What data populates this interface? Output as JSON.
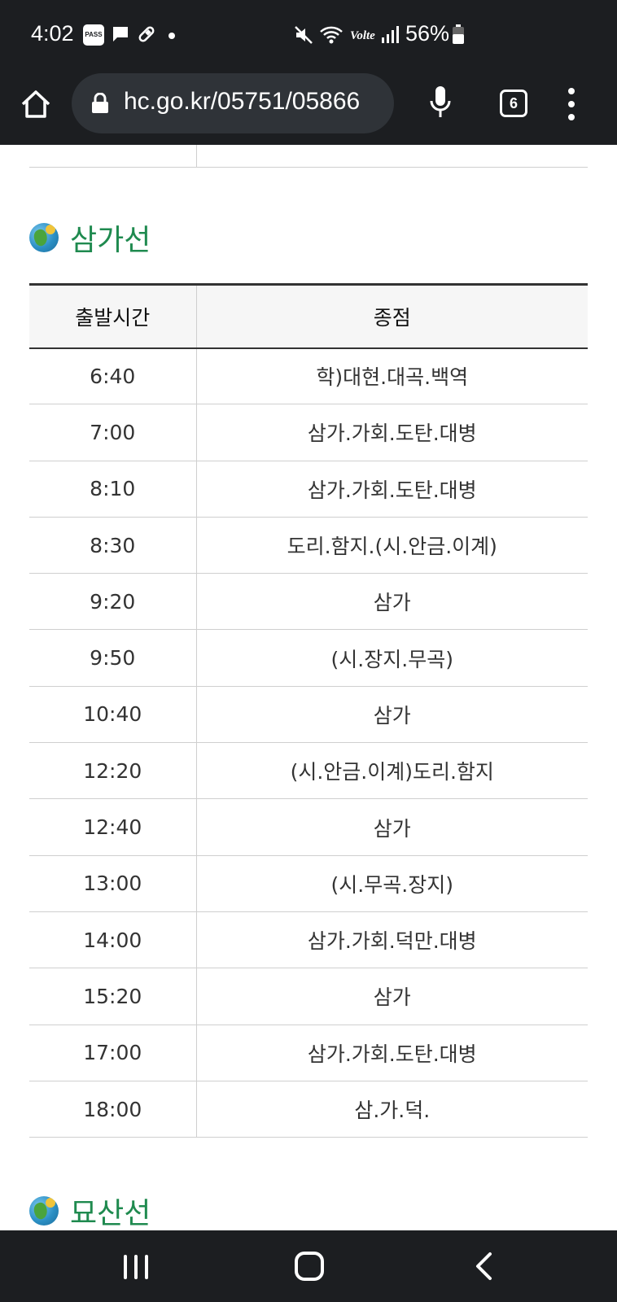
{
  "status_bar": {
    "time": "4:02",
    "pass_label": "PASS",
    "battery": "56%",
    "icons": [
      "pass-icon",
      "message-icon",
      "pill-icon",
      "dot-icon",
      "mute-icon",
      "wifi-icon",
      "volte-icon",
      "signal-icon",
      "battery-icon"
    ]
  },
  "browser": {
    "url": "hc.go.kr/05751/05866",
    "tab_count": "6"
  },
  "sections": {
    "samga": {
      "title": "삼가선",
      "headers": [
        "출발시간",
        "종점"
      ],
      "rows": [
        {
          "time": "6:40",
          "dest": "학)대현.대곡.백역"
        },
        {
          "time": "7:00",
          "dest": "삼가.가회.도탄.대병"
        },
        {
          "time": "8:10",
          "dest": "삼가.가회.도탄.대병"
        },
        {
          "time": "8:30",
          "dest": "도리.함지.(시.안금.이계)"
        },
        {
          "time": "9:20",
          "dest": "삼가"
        },
        {
          "time": "9:50",
          "dest": "(시.장지.무곡)"
        },
        {
          "time": "10:40",
          "dest": "삼가"
        },
        {
          "time": "12:20",
          "dest": "(시.안금.이계)도리.함지"
        },
        {
          "time": "12:40",
          "dest": "삼가"
        },
        {
          "time": "13:00",
          "dest": "(시.무곡.장지)"
        },
        {
          "time": "14:00",
          "dest": "삼가.가회.덕만.대병"
        },
        {
          "time": "15:20",
          "dest": "삼가"
        },
        {
          "time": "17:00",
          "dest": "삼가.가회.도탄.대병"
        },
        {
          "time": "18:00",
          "dest": "삼.가.덕."
        }
      ]
    },
    "next": {
      "title": "묘산선"
    }
  },
  "colors": {
    "section_title": "#1f8a4f",
    "system_bar": "#1c1e21"
  }
}
